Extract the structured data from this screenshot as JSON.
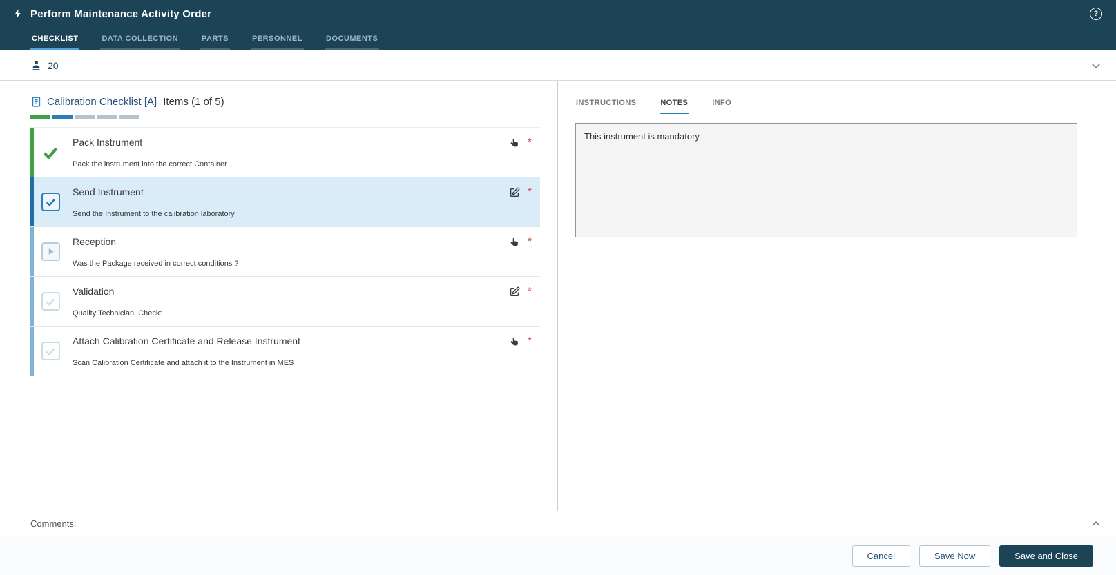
{
  "header": {
    "title": "Perform Maintenance Activity Order",
    "help_glyph": "?",
    "tabs": [
      {
        "label": "CHECKLIST",
        "active": true
      },
      {
        "label": "DATA COLLECTION",
        "active": false
      },
      {
        "label": "PARTS",
        "active": false
      },
      {
        "label": "PERSONNEL",
        "active": false
      },
      {
        "label": "DOCUMENTS",
        "active": false
      }
    ]
  },
  "personnel_bar": {
    "count": "20"
  },
  "checklist": {
    "title": "Calibration Checklist [A]",
    "items_label": "Items (1 of 5)",
    "progress": [
      "complete",
      "active",
      "pending",
      "pending",
      "pending"
    ],
    "items": [
      {
        "title": "Pack Instrument",
        "description": "Pack the instrument into the correct Container",
        "status": "complete",
        "action": "touch",
        "required": "*"
      },
      {
        "title": "Send Instrument",
        "description": "Send the Instrument to the calibration laboratory",
        "status": "checked-selected",
        "action": "edit",
        "required": "*"
      },
      {
        "title": "Reception",
        "description": "Was the Package received in correct conditions ?",
        "status": "ready-to-start",
        "action": "touch",
        "required": "*"
      },
      {
        "title": "Validation",
        "description": "Quality Technician. Check:",
        "status": "pending",
        "action": "edit",
        "required": "*"
      },
      {
        "title": "Attach Calibration Certificate and Release Instrument",
        "description": "Scan Calibration Certificate and attach it to the Instrument in MES",
        "status": "pending",
        "action": "touch",
        "required": "*"
      }
    ]
  },
  "detail_panel": {
    "tabs": [
      {
        "label": "INSTRUCTIONS",
        "active": false
      },
      {
        "label": "NOTES",
        "active": true
      },
      {
        "label": "INFO",
        "active": false
      }
    ],
    "notes_text": "This instrument is mandatory."
  },
  "comments": {
    "label": "Comments:"
  },
  "footer": {
    "cancel_label": "Cancel",
    "save_now_label": "Save Now",
    "save_close_label": "Save and Close"
  },
  "colors": {
    "header_bg": "#1d4456",
    "tab_underline": "#4da3dc",
    "accent_blue": "#2d7fb8",
    "success_green": "#43a047",
    "selected_row": "#d9ecf7",
    "required_red": "#c0392b",
    "primary_button_bg": "#1d4456"
  }
}
